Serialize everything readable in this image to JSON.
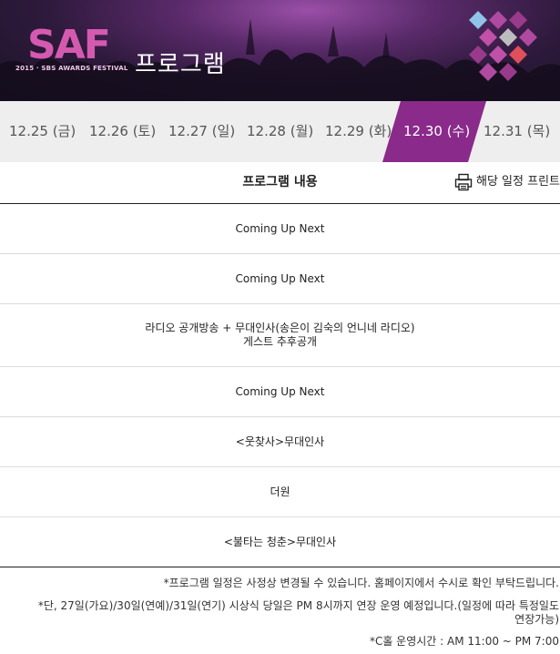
{
  "header": {
    "logo_text": "SAF",
    "logo_subtitle": "2015 · SBS AWARDS FESTIVAL",
    "title": "프로그램",
    "accent_color": "#8a2a8a"
  },
  "tabs": [
    {
      "label": "12.25 (금)"
    },
    {
      "label": "12.26 (토)"
    },
    {
      "label": "12.27 (일)"
    },
    {
      "label": "12.28 (월)"
    },
    {
      "label": "12.29 (화)"
    },
    {
      "label": "12.30 (수)",
      "active": true
    },
    {
      "label": "12.31 (목)"
    }
  ],
  "table": {
    "header": "프로그램 내용",
    "print_label": "해당 일정 프린트",
    "print_icon": "printer-icon",
    "rows": [
      {
        "line1": "Coming Up Next",
        "line2": ""
      },
      {
        "line1": "Coming Up Next",
        "line2": ""
      },
      {
        "line1": "라디오 공개방송 + 무대인사(송은이 김숙의 언니네 라디오)",
        "line2": "게스트 추후공개"
      },
      {
        "line1": "Coming Up Next",
        "line2": ""
      },
      {
        "line1": "<웃찾사>무대인사",
        "line2": ""
      },
      {
        "line1": "더원",
        "line2": ""
      },
      {
        "line1": "<불타는 청춘>무대인사",
        "line2": ""
      }
    ]
  },
  "notes": {
    "note1": "*프로그램 일정은 사정상 변경될 수 있습니다. 홈페이지에서 수시로 확인 부탁드립니다.",
    "note2_line1": "*단, 27일(가요)/30일(연예)/31일(연기) 시상식 당일은 PM 8시까지 연장 운영 예정입니다.(일정에 따라 특정일도",
    "note2_line2": "연장가능)",
    "note3": "*C홀 운영시간 : AM 11:00 ~ PM 7:00"
  }
}
